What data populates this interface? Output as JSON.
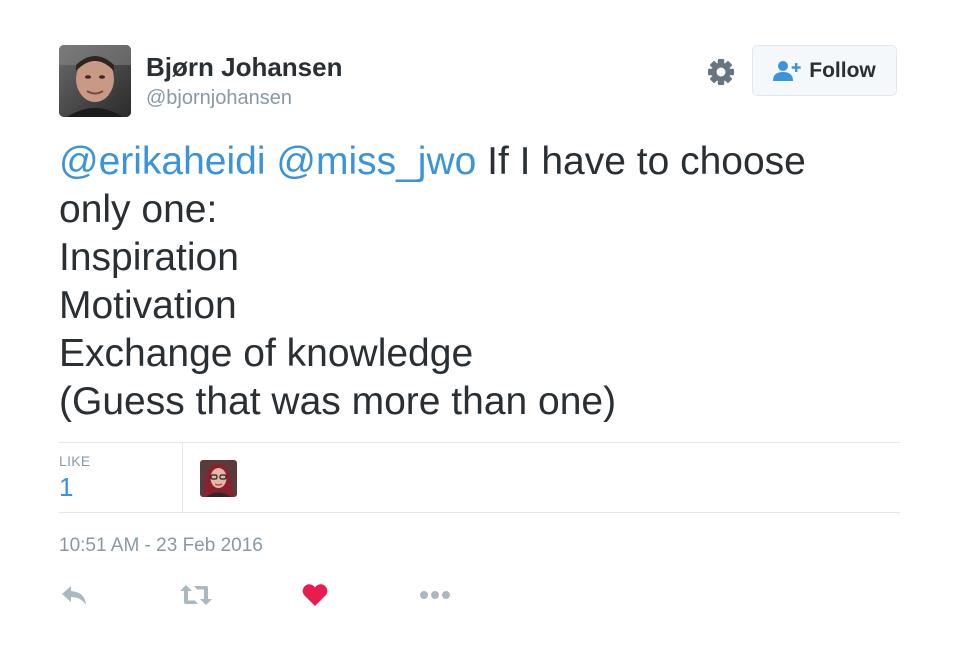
{
  "author": {
    "name": "Bjørn Johansen",
    "handle": "@bjornjohansen"
  },
  "header": {
    "settings_icon": "gear-icon",
    "follow_icon": "person-plus-icon",
    "follow_label": "Follow"
  },
  "tweet": {
    "mention_1": "@erikaheidi",
    "mention_2": "@miss_jwo",
    "line_1_text": " If I have to choose",
    "line_2": "only one:",
    "line_3": "Inspiration",
    "line_4": "Motivation",
    "line_5": "Exchange of knowledge",
    "line_6": "(Guess that was more than one)"
  },
  "stats": {
    "likes_label": "LIKE",
    "likes_count": "1"
  },
  "timestamp": "10:51 AM - 23 Feb 2016",
  "actions": {
    "reply_icon": "reply-icon",
    "retweet_icon": "retweet-icon",
    "like_icon": "heart-icon",
    "more_icon": "more-dots-icon"
  },
  "colors": {
    "mention": "#3b94d9",
    "text": "#292f33",
    "muted": "#8899a6",
    "heart": "#e81c4f",
    "icon_gray": "#aab8c2",
    "divider": "#e1e8ed"
  }
}
